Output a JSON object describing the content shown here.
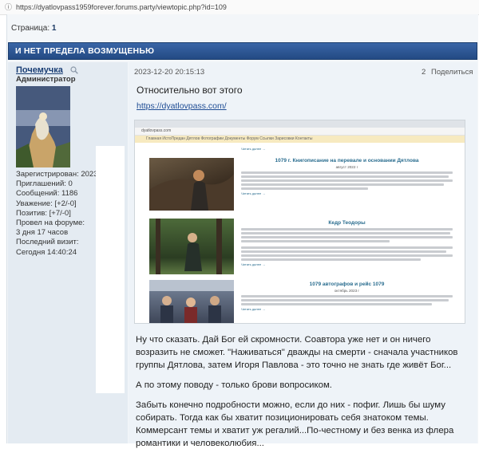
{
  "browser": {
    "url": "https://dyatlovpass1959forever.forums.party/viewtopic.php?id=109"
  },
  "pager": {
    "label": "Страница:",
    "page": "1"
  },
  "topic": {
    "title": "И НЕТ ПРЕДЕЛА ВОЗМУЩЕНЬЮ"
  },
  "user": {
    "name": "Почемучка",
    "role": "Администратор",
    "stats": [
      "Зарегистрирован: 2023-",
      "Приглашений: 0",
      "Сообщений: 1186",
      "Уважение: [+2/-0]",
      "Позитив: [+7/-0]",
      "Провел на форуме:",
      "3 дня 17 часов",
      "Последний визит:",
      "Сегодня 14:40:24"
    ]
  },
  "post": {
    "date": "2023-12-20 20:15:13",
    "number": "2",
    "share_label": "Поделиться",
    "quote_title": "Относительно вот этого",
    "link": "https://dyatlovpass.com/",
    "paragraphs": [
      "Ну что сказать. Дай Бог ей скромности. Соавтора уже нет и он ничего возразить не сможет. \"Наживаться\" дважды на смерти - сначала участников группы Дятлова, затем Игоря Павлова - это точно не знать где живёт Бог...",
      "А по этому поводу - только брови вопросиком.",
      "Забыть конечно подробности можно, если до них - пофиг. Лишь бы шуму собирать. Тогда как бы хватит позиционировать себя знатоком темы. Коммерсант темы и хватит уж регалий...По-честному и без венка из флера романтики и человеколюбия..."
    ]
  },
  "embed": {
    "url": "dyatlovpass.com",
    "nav": "Главная   ИстоПредан   Дятлов   Фотографии   Документы   Форум   Ссылки   Зарисовки   Контакты",
    "sections": [
      {
        "title": "1079 г. Книгописание на перевале и основании Дятлова",
        "date": "август 2022 г",
        "more": "Читать далее →"
      },
      {
        "title": "Кедр Теодоры",
        "date": "",
        "more": "Читать далее →"
      },
      {
        "title": "1079 автографов и рейс 1079",
        "date": "октябрь 2023 г",
        "more": "Читать далее →"
      }
    ]
  },
  "colors": {
    "topic_bar": "#2c5591",
    "left_col": "#e4ebf2",
    "right_col": "#eef3f8",
    "link": "#1e4c94"
  }
}
